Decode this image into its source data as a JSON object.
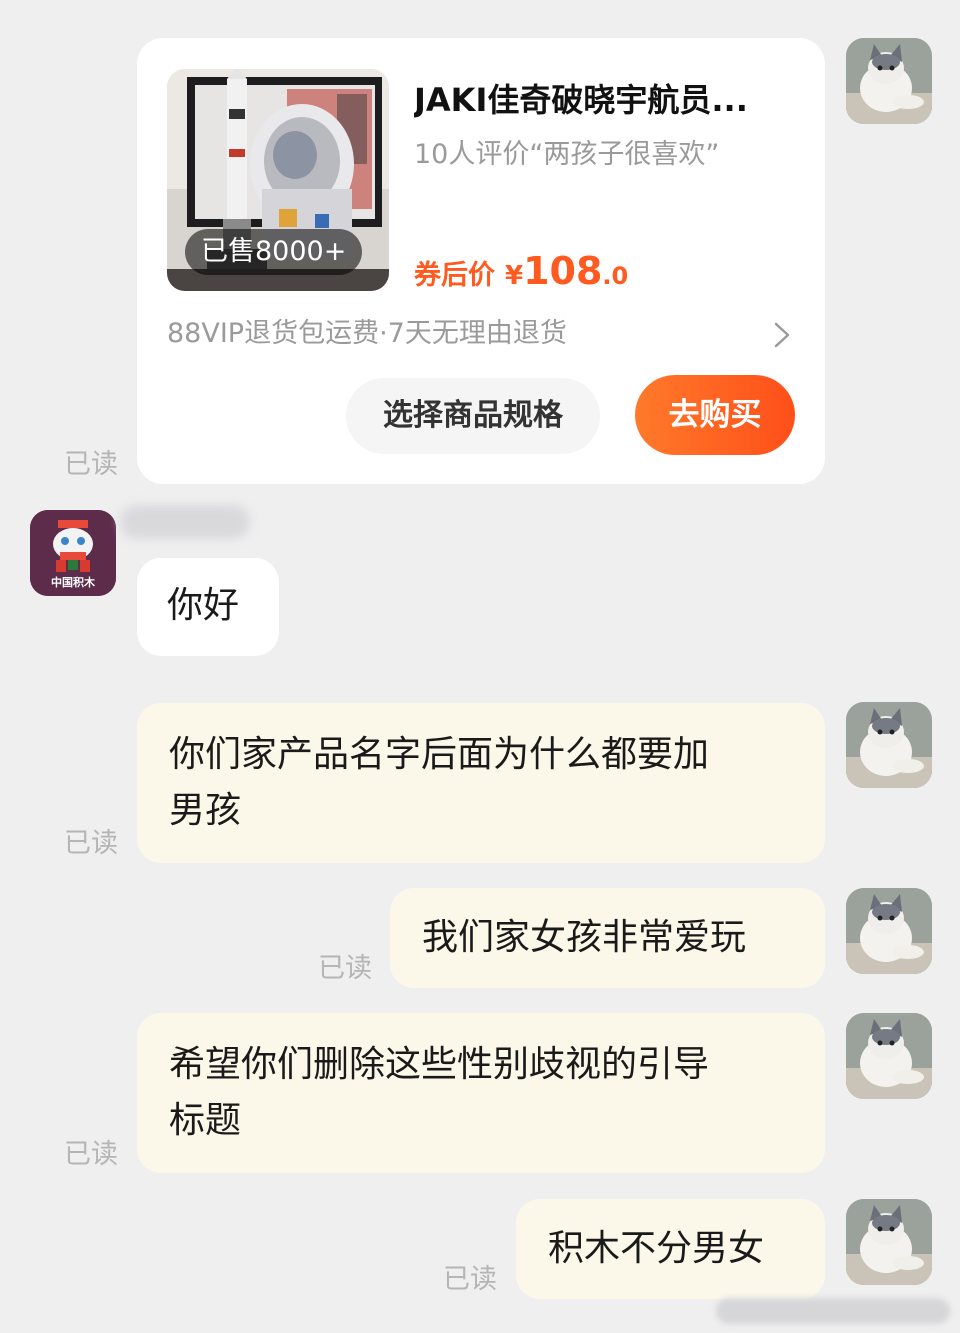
{
  "product_card": {
    "sold_badge": "已售8000+",
    "title": "JAKI佳奇破晓宇航员...",
    "review": "10人评价“两孩子很喜欢”",
    "price_label": "券后价",
    "price_currency": "¥",
    "price_integer": "108",
    "price_decimal": ".0",
    "services": "88VIP退货包运费·7天无理由退货",
    "spec_button": "选择商品规格",
    "buy_button": "去购买",
    "thumbnail_icon": "astronaut-rocket-lego-image"
  },
  "shop": {
    "avatar_text": "中国积木"
  },
  "messages": [
    {
      "sender": "self",
      "text": "",
      "read": "已读",
      "type": "product_card"
    },
    {
      "sender": "shop",
      "text": "你好"
    },
    {
      "sender": "self",
      "line1": "你们家产品名字后面为什么都要加",
      "line2": "男孩",
      "read": "已读"
    },
    {
      "sender": "self",
      "text": "我们家女孩非常爱玩",
      "read": "已读"
    },
    {
      "sender": "self",
      "line1": "希望你们删除这些性别歧视的引导",
      "line2": "标题",
      "read": "已读"
    },
    {
      "sender": "self",
      "text": "积木不分男女",
      "read": "已读"
    }
  ],
  "colors": {
    "background": "#efeff0",
    "accent_orange": "#ff5a1f",
    "self_bubble": "#fbf8ea",
    "other_bubble": "#ffffff"
  }
}
